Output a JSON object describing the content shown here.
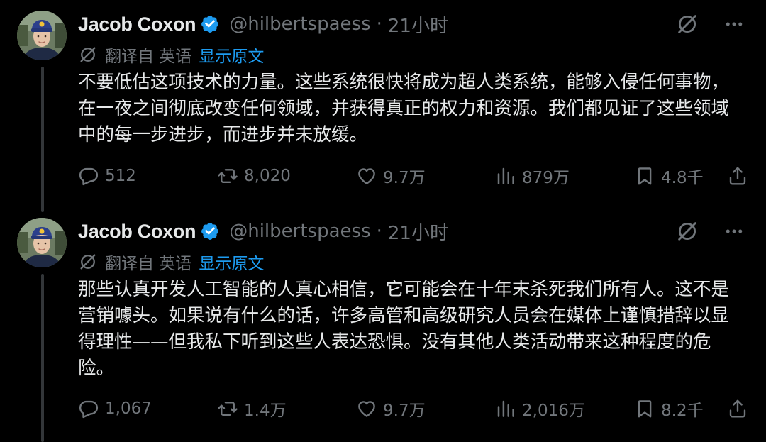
{
  "tweets": [
    {
      "author": {
        "name": "Jacob Coxon",
        "handle": "@hilbertspaess"
      },
      "separator": "·",
      "time": "21小时",
      "translation": {
        "from": "翻译自 英语",
        "show_original": "显示原文"
      },
      "text": "不要低估这项技术的力量。这些系统很快将成为超人类系统，能够入侵任何事物，在一夜之间彻底改变任何领域，并获得真正的权力和资源。我们都见证了这些领域中的每一步进步，而进步并未放缓。",
      "stats": {
        "replies": "512",
        "retweets": "8,020",
        "likes": "9.7万",
        "views": "879万",
        "bookmarks": "4.8千"
      }
    },
    {
      "author": {
        "name": "Jacob Coxon",
        "handle": "@hilbertspaess"
      },
      "separator": "·",
      "time": "21小时",
      "translation": {
        "from": "翻译自 英语",
        "show_original": "显示原文"
      },
      "text": "那些认真开发人工智能的人真心相信，它可能会在十年末杀死我们所有人。这不是营销噱头。如果说有什么的话，许多高管和高级研究人员会在媒体上谨慎措辞以显得理性——但我私下听到这些人表达恐惧。没有其他人类活动带来这种程度的危险。",
      "stats": {
        "replies": "1,067",
        "retweets": "1.4万",
        "likes": "9.7万",
        "views": "2,016万",
        "bookmarks": "8.2千"
      }
    }
  ],
  "colors": {
    "background": "#000000",
    "text": "#e7e9ea",
    "muted": "#71767b",
    "accent": "#1d9bf0",
    "thread_line": "#333639"
  },
  "icons": [
    "verified-badge-icon",
    "grok-icon",
    "more-icon",
    "translate-icon",
    "reply-icon",
    "retweet-icon",
    "like-icon",
    "views-icon",
    "bookmark-icon",
    "share-icon"
  ]
}
